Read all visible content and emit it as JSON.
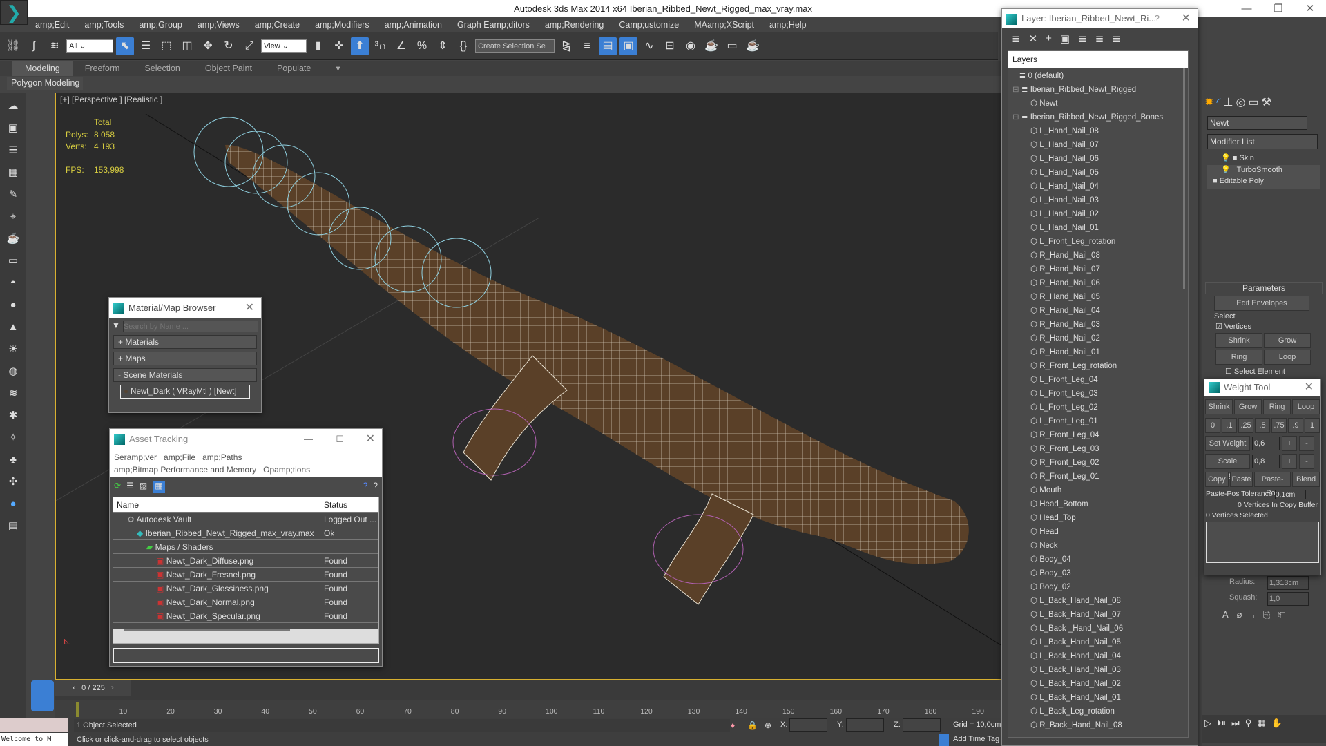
{
  "title": "Autodesk 3ds Max  2014 x64     Iberian_Ribbed_Newt_Rigged_max_vray.max",
  "menu": [
    "amp;Edit",
    "amp;Tools",
    "amp;Group",
    "amp;Views",
    "amp;Create",
    "amp;Modifiers",
    "amp;Animation",
    "Graph Eamp;ditors",
    "amp;Rendering",
    "Camp;ustomize",
    "MAamp;XScript",
    "amp;Help"
  ],
  "toolbar": {
    "filter": "All",
    "ref_coord": "View",
    "selection_set": "Create Selection Se"
  },
  "ribbon": {
    "tabs": [
      "Modeling",
      "Freeform",
      "Selection",
      "Object Paint",
      "Populate"
    ],
    "sub": "Polygon Modeling"
  },
  "viewport": {
    "label": "[+] [Perspective ] [Realistic ]",
    "total": "Total",
    "polys_label": "Polys:",
    "polys": "8 058",
    "verts_label": "Verts:",
    "verts": "4 193",
    "fps_label": "FPS:",
    "fps": "153,998"
  },
  "material_browser": {
    "title": "Material/Map Browser",
    "search_placeholder": "Search by Name ...",
    "materials": "+ Materials",
    "maps": "+ Maps",
    "scene_materials": "- Scene Materials",
    "item": "Newt_Dark ( VRayMtl ) [Newt]"
  },
  "asset_tracking": {
    "title": "Asset Tracking",
    "menu1": [
      "Seramp;ver",
      "amp;File",
      "amp;Paths"
    ],
    "menu2": [
      "amp;Bitmap Performance and Memory",
      "Opamp;tions"
    ],
    "col_name": "Name",
    "col_status": "Status",
    "rows": [
      {
        "name": "Autodesk Vault",
        "status": "Logged Out ...",
        "indent": 1
      },
      {
        "name": "Iberian_Ribbed_Newt_Rigged_max_vray.max",
        "status": "Ok",
        "indent": 2
      },
      {
        "name": "Maps / Shaders",
        "status": "",
        "indent": 3
      },
      {
        "name": "Newt_Dark_Diffuse.png",
        "status": "Found",
        "indent": 4
      },
      {
        "name": "Newt_Dark_Fresnel.png",
        "status": "Found",
        "indent": 4
      },
      {
        "name": "Newt_Dark_Glossiness.png",
        "status": "Found",
        "indent": 4
      },
      {
        "name": "Newt_Dark_Normal.png",
        "status": "Found",
        "indent": 4
      },
      {
        "name": "Newt_Dark_Specular.png",
        "status": "Found",
        "indent": 4
      }
    ]
  },
  "layer_dialog": {
    "title": "Layer: Iberian_Ribbed_Newt_Ri...",
    "help": "?",
    "header": "Layers",
    "items": [
      {
        "n": "0 (default)",
        "l": 0
      },
      {
        "n": "Iberian_Ribbed_Newt_Rigged",
        "l": 0
      },
      {
        "n": "Newt",
        "l": 1
      },
      {
        "n": "Iberian_Ribbed_Newt_Rigged_Bones",
        "l": 0
      },
      {
        "n": "L_Hand_Nail_08",
        "l": 1
      },
      {
        "n": "L_Hand_Nail_07",
        "l": 1
      },
      {
        "n": "L_Hand_Nail_06",
        "l": 1
      },
      {
        "n": "L_Hand_Nail_05",
        "l": 1
      },
      {
        "n": "L_Hand_Nail_04",
        "l": 1
      },
      {
        "n": "L_Hand_Nail_03",
        "l": 1
      },
      {
        "n": "L_Hand_Nail_02",
        "l": 1
      },
      {
        "n": "L_Hand_Nail_01",
        "l": 1
      },
      {
        "n": "L_Front_Leg_rotation",
        "l": 1
      },
      {
        "n": "R_Hand_Nail_08",
        "l": 1
      },
      {
        "n": "R_Hand_Nail_07",
        "l": 1
      },
      {
        "n": "R_Hand_Nail_06",
        "l": 1
      },
      {
        "n": "R_Hand_Nail_05",
        "l": 1
      },
      {
        "n": "R_Hand_Nail_04",
        "l": 1
      },
      {
        "n": "R_Hand_Nail_03",
        "l": 1
      },
      {
        "n": "R_Hand_Nail_02",
        "l": 1
      },
      {
        "n": "R_Hand_Nail_01",
        "l": 1
      },
      {
        "n": "R_Front_Leg_rotation",
        "l": 1
      },
      {
        "n": "L_Front_Leg_04",
        "l": 1
      },
      {
        "n": "L_Front_Leg_03",
        "l": 1
      },
      {
        "n": "L_Front_Leg_02",
        "l": 1
      },
      {
        "n": "L_Front_Leg_01",
        "l": 1
      },
      {
        "n": "R_Front_Leg_04",
        "l": 1
      },
      {
        "n": "R_Front_Leg_03",
        "l": 1
      },
      {
        "n": "R_Front_Leg_02",
        "l": 1
      },
      {
        "n": "R_Front_Leg_01",
        "l": 1
      },
      {
        "n": "Mouth",
        "l": 1
      },
      {
        "n": "Head_Bottom",
        "l": 1
      },
      {
        "n": "Head_Top",
        "l": 1
      },
      {
        "n": "Head",
        "l": 1
      },
      {
        "n": "Neck",
        "l": 1
      },
      {
        "n": "Body_04",
        "l": 1
      },
      {
        "n": "Body_03",
        "l": 1
      },
      {
        "n": "Body_02",
        "l": 1
      },
      {
        "n": "L_Back_Hand_Nail_08",
        "l": 1
      },
      {
        "n": "L_Back_Hand_Nail_07",
        "l": 1
      },
      {
        "n": "L_Back _Hand_Nail_06",
        "l": 1
      },
      {
        "n": "L_Back_Hand_Nail_05",
        "l": 1
      },
      {
        "n": "L_Back_Hand_Nail_04",
        "l": 1
      },
      {
        "n": "L_Back_Hand_Nail_03",
        "l": 1
      },
      {
        "n": "L_Back_Hand_Nail_02",
        "l": 1
      },
      {
        "n": "L_Back_Hand_Nail_01",
        "l": 1
      },
      {
        "n": "L_Back_Leg_rotation",
        "l": 1
      },
      {
        "n": "R_Back_Hand_Nail_08",
        "l": 1
      }
    ]
  },
  "command_panel": {
    "object_name": "Newt",
    "modifier_list": "Modifier List",
    "stack": [
      "Skin",
      "TurboSmooth",
      "Editable Poly"
    ],
    "parameters": "Parameters",
    "edit_envelopes": "Edit Envelopes",
    "select_group": "Select",
    "vertices": "Vertices",
    "shrink": "Shrink",
    "grow": "Grow",
    "ring": "Ring",
    "loop": "Loop",
    "select_element": "Select Element",
    "radius_label": "Radius:",
    "radius": "1,313cm",
    "squash_label": "Squash:",
    "squash": "1,0"
  },
  "weight_tool": {
    "title": "Weight Tool",
    "row1": [
      "Shrink",
      "Grow",
      "Ring",
      "Loop"
    ],
    "presets": [
      "0",
      ".1",
      ".25",
      ".5",
      ".75",
      ".9",
      "1"
    ],
    "set_weight": "Set Weight",
    "set_value": "0,6",
    "scale_weight": "Scale Weight",
    "scale_value": "0,8",
    "plus": "+",
    "minus": "-",
    "row4": [
      "Copy",
      "Paste",
      "Paste-Pos",
      "Blend"
    ],
    "tolerance_label": "Paste-Pos Tolerance",
    "tolerance": "0,1cm",
    "copy_buffer": "0 Vertices In Copy Buffer",
    "selected": "0 Vertices Selected"
  },
  "timeline": {
    "frame": "0 / 225",
    "ticks": [
      "10",
      "20",
      "30",
      "40",
      "50",
      "60",
      "70",
      "80",
      "90",
      "100",
      "110",
      "120",
      "130",
      "140",
      "150",
      "160",
      "170",
      "180",
      "190"
    ]
  },
  "status": {
    "selected": "1 Object Selected",
    "prompt": "Click or click-and-drag to select objects",
    "x": "X:",
    "y": "Y:",
    "z": "Z:",
    "grid": "Grid = 10,0cm",
    "add_time_tag": "Add Time Tag",
    "maxscript": "Welcome to M"
  }
}
